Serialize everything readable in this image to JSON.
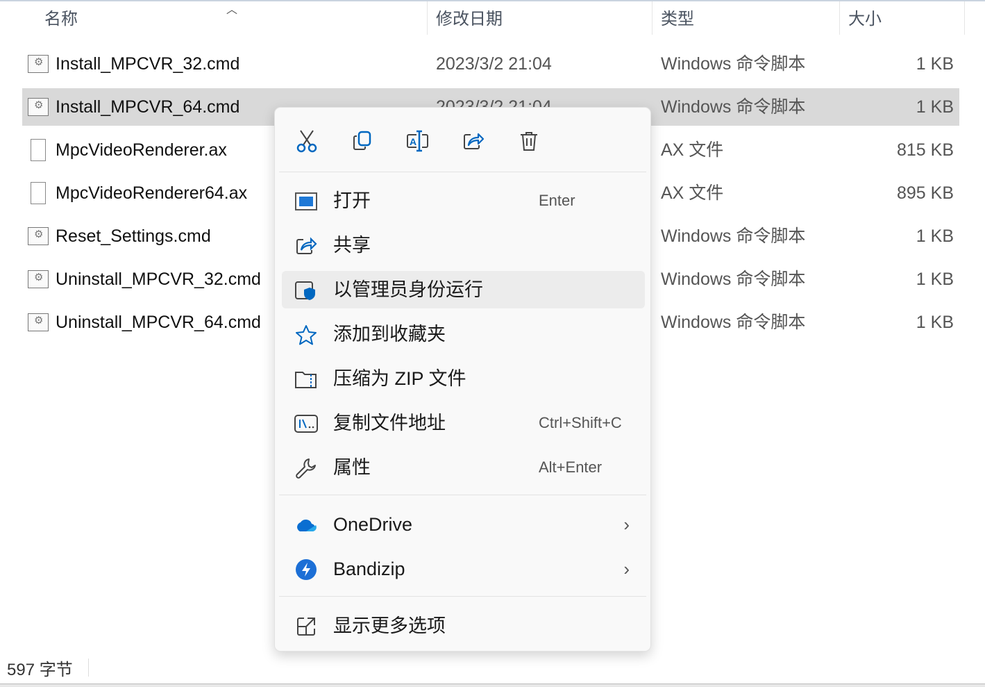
{
  "columns": {
    "name": "名称",
    "date": "修改日期",
    "type": "类型",
    "size": "大小"
  },
  "files": [
    {
      "name": "Install_MPCVR_32.cmd",
      "date": "2023/3/2 21:04",
      "type": "Windows 命令脚本",
      "size": "1 KB",
      "icon": "cmd"
    },
    {
      "name": "Install_MPCVR_64.cmd",
      "date": "2023/3/2 21:04",
      "type": "Windows 命令脚本",
      "size": "1 KB",
      "icon": "cmd",
      "selected": true
    },
    {
      "name": "MpcVideoRenderer.ax",
      "date": "",
      "type": "AX 文件",
      "size": "815 KB",
      "icon": "file"
    },
    {
      "name": "MpcVideoRenderer64.ax",
      "date": "",
      "type": "AX 文件",
      "size": "895 KB",
      "icon": "file"
    },
    {
      "name": "Reset_Settings.cmd",
      "date": "",
      "type": "Windows 命令脚本",
      "size": "1 KB",
      "icon": "cmd"
    },
    {
      "name": "Uninstall_MPCVR_32.cmd",
      "date": "",
      "type": "Windows 命令脚本",
      "size": "1 KB",
      "icon": "cmd"
    },
    {
      "name": "Uninstall_MPCVR_64.cmd",
      "date": "",
      "type": "Windows 命令脚本",
      "size": "1 KB",
      "icon": "cmd"
    }
  ],
  "status": "597 字节",
  "menu": {
    "toolbar": [
      "cut",
      "copy",
      "rename",
      "share",
      "delete"
    ],
    "items": [
      {
        "label": "打开",
        "shortcut": "Enter",
        "icon": "open-icon"
      },
      {
        "label": "共享",
        "shortcut": "",
        "icon": "share-icon"
      },
      {
        "label": "以管理员身份运行",
        "shortcut": "",
        "icon": "shield-icon"
      },
      {
        "label": "添加到收藏夹",
        "shortcut": "",
        "icon": "star-icon"
      },
      {
        "label": "压缩为 ZIP 文件",
        "shortcut": "",
        "icon": "zip-icon"
      },
      {
        "label": "复制文件地址",
        "shortcut": "Ctrl+Shift+C",
        "icon": "path-icon"
      },
      {
        "label": "属性",
        "shortcut": "Alt+Enter",
        "icon": "wrench-icon"
      }
    ],
    "submenus": [
      {
        "label": "OneDrive",
        "icon": "onedrive-icon"
      },
      {
        "label": "Bandizip",
        "icon": "bandizip-icon"
      }
    ],
    "more": "显示更多选项"
  },
  "colors": {
    "accent": "#0067c0",
    "selection": "#d9d9d9"
  }
}
